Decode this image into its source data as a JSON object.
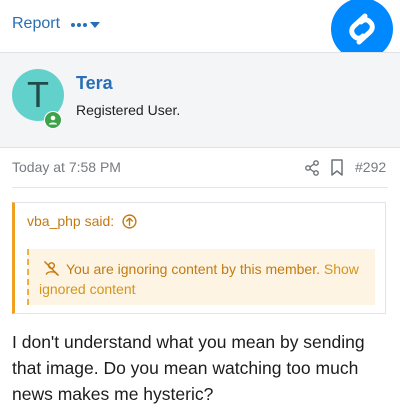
{
  "actions": {
    "report_label": "Report",
    "more_icon": "ellipsis-icon"
  },
  "overlay": {
    "icon": "shazam-icon",
    "color": "#0088ff"
  },
  "user": {
    "avatar_letter": "T",
    "avatar_color": "#63d1cb",
    "name": "Tera",
    "title": "Registered User.",
    "status_icon": "online-status-icon"
  },
  "post": {
    "date": "Today at 7:58 PM",
    "number": "#292",
    "share_icon": "share-icon",
    "bookmark_icon": "bookmark-icon",
    "quote": {
      "author_label": "vba_php said:",
      "ignored_text": "You are ignoring content by this member.",
      "show_link": "Show ignored content"
    },
    "message": "I don't understand what you mean by sending that image. Do you mean watching too much news makes me hysteric?"
  },
  "colors": {
    "link": "#2a6fb5",
    "quote_accent": "#f0a020",
    "ignored_bg": "#fdf4e4",
    "ignored_text": "#c57a0f"
  }
}
